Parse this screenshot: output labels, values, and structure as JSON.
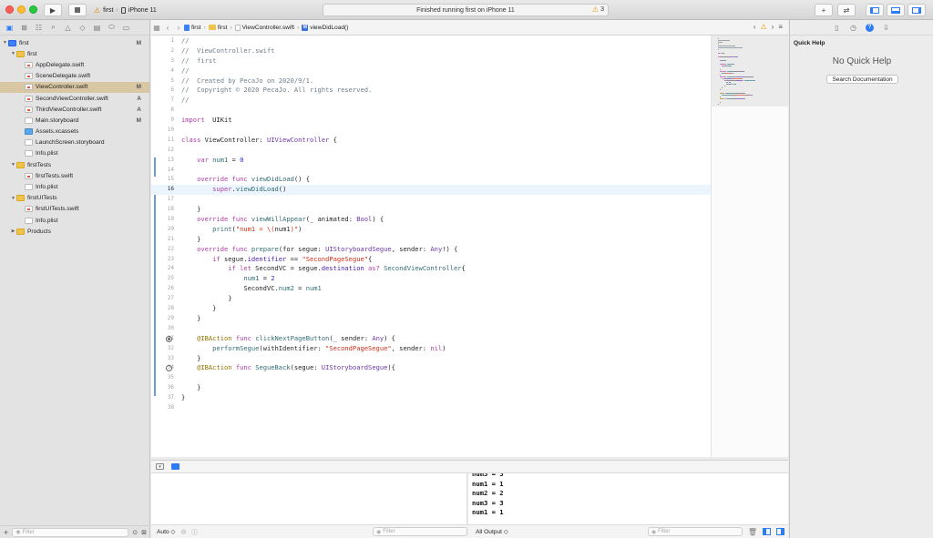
{
  "toolbar": {
    "scheme_target": "first",
    "device": "iPhone 11",
    "activity_status": "Finished running first on iPhone 11",
    "warning_count": "3"
  },
  "navigator": {
    "filter_placeholder": "Filter",
    "items": [
      {
        "label": "first",
        "icon": "project-icon",
        "indent": 0,
        "disclosure": "▼",
        "badge": "M"
      },
      {
        "label": "first",
        "icon": "folder-icon",
        "indent": 1,
        "disclosure": "▼",
        "badge": ""
      },
      {
        "label": "AppDelegate.swift",
        "icon": "swift-file-icon",
        "indent": 2,
        "disclosure": "",
        "badge": ""
      },
      {
        "label": "SceneDelegate.swift",
        "icon": "swift-file-icon",
        "indent": 2,
        "disclosure": "",
        "badge": ""
      },
      {
        "label": "ViewController.swift",
        "icon": "swift-file-icon",
        "indent": 2,
        "disclosure": "",
        "badge": "M",
        "selected": true
      },
      {
        "label": "SecondViewController.swift",
        "icon": "swift-file-icon",
        "indent": 2,
        "disclosure": "",
        "badge": "A"
      },
      {
        "label": "ThirdViewController.swift",
        "icon": "swift-file-icon",
        "indent": 2,
        "disclosure": "",
        "badge": "A"
      },
      {
        "label": "Main.storyboard",
        "icon": "storyboard-icon",
        "indent": 2,
        "disclosure": "",
        "badge": "M"
      },
      {
        "label": "Assets.xcassets",
        "icon": "assets-icon",
        "indent": 2,
        "disclosure": "",
        "badge": ""
      },
      {
        "label": "LaunchScreen.storyboard",
        "icon": "storyboard-icon",
        "indent": 2,
        "disclosure": "",
        "badge": ""
      },
      {
        "label": "Info.plist",
        "icon": "plist-icon",
        "indent": 2,
        "disclosure": "",
        "badge": ""
      },
      {
        "label": "firstTests",
        "icon": "folder-icon",
        "indent": 1,
        "disclosure": "▼",
        "badge": ""
      },
      {
        "label": "firstTests.swift",
        "icon": "swift-file-icon",
        "indent": 2,
        "disclosure": "",
        "badge": ""
      },
      {
        "label": "Info.plist",
        "icon": "plist-icon",
        "indent": 2,
        "disclosure": "",
        "badge": ""
      },
      {
        "label": "firstUITests",
        "icon": "folder-icon",
        "indent": 1,
        "disclosure": "▼",
        "badge": ""
      },
      {
        "label": "firstUITests.swift",
        "icon": "swift-file-icon",
        "indent": 2,
        "disclosure": "",
        "badge": ""
      },
      {
        "label": "Info.plist",
        "icon": "plist-icon",
        "indent": 2,
        "disclosure": "",
        "badge": ""
      },
      {
        "label": "Products",
        "icon": "folder-icon",
        "indent": 1,
        "disclosure": "▶",
        "badge": ""
      }
    ]
  },
  "jumpbar": {
    "crumbs": [
      "first",
      "first",
      "ViewController.swift",
      "viewDidLoad()"
    ]
  },
  "code": {
    "lines": [
      [
        [
          "cm",
          "//"
        ]
      ],
      [
        [
          "cm",
          "//  ViewController.swift"
        ]
      ],
      [
        [
          "cm",
          "//  first"
        ]
      ],
      [
        [
          "cm",
          "//"
        ]
      ],
      [
        [
          "cm",
          "//  Created by PecaJo on 2020/9/1."
        ]
      ],
      [
        [
          "cm",
          "//  Copyright © 2020 PecaJo. All rights reserved."
        ]
      ],
      [
        [
          "cm",
          "//"
        ]
      ],
      [],
      [
        [
          "kw",
          "import"
        ],
        [
          "",
          "  UIKit"
        ]
      ],
      [],
      [
        [
          "kw",
          "class"
        ],
        [
          "",
          " ViewController: "
        ],
        [
          "ty",
          "UIViewController"
        ],
        [
          "",
          " {"
        ]
      ],
      [],
      [
        [
          "",
          "    "
        ],
        [
          "kw",
          "var"
        ],
        [
          "vr",
          " num1"
        ],
        [
          "",
          " = "
        ],
        [
          "nm",
          "0"
        ]
      ],
      [],
      [
        [
          "",
          "    "
        ],
        [
          "kw",
          "override"
        ],
        [
          "",
          " "
        ],
        [
          "kw",
          "func"
        ],
        [
          "",
          " "
        ],
        [
          "fn",
          "viewDidLoad"
        ],
        [
          "",
          "() {"
        ]
      ],
      [
        [
          "",
          "        "
        ],
        [
          "kw",
          "super"
        ],
        [
          "",
          "."
        ],
        [
          "mthd",
          "viewDidLoad"
        ],
        [
          "",
          "()"
        ]
      ],
      [],
      [
        [
          "",
          "    }"
        ]
      ],
      [
        [
          "",
          "    "
        ],
        [
          "kw",
          "override"
        ],
        [
          "",
          " "
        ],
        [
          "kw",
          "func"
        ],
        [
          "",
          " "
        ],
        [
          "fn",
          "viewWillAppear"
        ],
        [
          "",
          "(_ animated: "
        ],
        [
          "ty",
          "Bool"
        ],
        [
          "",
          ") {"
        ]
      ],
      [
        [
          "",
          "        "
        ],
        [
          "mthd",
          "print"
        ],
        [
          "",
          "("
        ],
        [
          "st",
          "\"num1 = \\("
        ],
        [
          "",
          "num1"
        ],
        [
          "st",
          ")\""
        ],
        [
          "",
          ")"
        ]
      ],
      [
        [
          "",
          "    }"
        ]
      ],
      [
        [
          "",
          "    "
        ],
        [
          "kw",
          "override"
        ],
        [
          "",
          " "
        ],
        [
          "kw",
          "func"
        ],
        [
          "",
          " "
        ],
        [
          "fn",
          "prepare"
        ],
        [
          "",
          "(for segue: "
        ],
        [
          "ty",
          "UIStoryboardSegue"
        ],
        [
          "",
          ", sender: "
        ],
        [
          "ty",
          "Any"
        ],
        [
          "",
          "!) {"
        ]
      ],
      [
        [
          "",
          "        "
        ],
        [
          "kw",
          "if"
        ],
        [
          "",
          " segue."
        ],
        [
          "prop",
          "identifier"
        ],
        [
          "",
          " == "
        ],
        [
          "st",
          "\"SecondPageSegue\""
        ],
        [
          "",
          "{"
        ]
      ],
      [
        [
          "",
          "            "
        ],
        [
          "kw",
          "if"
        ],
        [
          "",
          " "
        ],
        [
          "kw",
          "let"
        ],
        [
          "",
          " SecondVC = segue."
        ],
        [
          "prop",
          "destination"
        ],
        [
          "",
          " "
        ],
        [
          "kw",
          "as?"
        ],
        [
          "",
          " "
        ],
        [
          "fn",
          "SecondViewController"
        ],
        [
          "",
          "{"
        ]
      ],
      [
        [
          "",
          "                "
        ],
        [
          "vr",
          "num1"
        ],
        [
          "",
          " = "
        ],
        [
          "nm",
          "2"
        ]
      ],
      [
        [
          "",
          "                SecondVC."
        ],
        [
          "vr",
          "num2"
        ],
        [
          "",
          " = "
        ],
        [
          "vr",
          "num1"
        ]
      ],
      [
        [
          "",
          "            }"
        ]
      ],
      [
        [
          "",
          "        }"
        ]
      ],
      [
        [
          "",
          "    }"
        ]
      ],
      [],
      [
        [
          "",
          "    "
        ],
        [
          "at",
          "@IBAction"
        ],
        [
          "",
          " "
        ],
        [
          "kw",
          "func"
        ],
        [
          "",
          " "
        ],
        [
          "fn",
          "clickNextPageButton"
        ],
        [
          "",
          "(_ sender: "
        ],
        [
          "ty",
          "Any"
        ],
        [
          "",
          ") {"
        ]
      ],
      [
        [
          "",
          "        "
        ],
        [
          "mthd",
          "performSegue"
        ],
        [
          "",
          "(withIdentifier: "
        ],
        [
          "st",
          "\"SecondPageSegue\""
        ],
        [
          "",
          ", sender: "
        ],
        [
          "kw",
          "nil"
        ],
        [
          "",
          ")"
        ]
      ],
      [
        [
          "",
          "    }"
        ]
      ],
      [
        [
          "",
          "    "
        ],
        [
          "at",
          "@IBAction"
        ],
        [
          "",
          " "
        ],
        [
          "kw",
          "func"
        ],
        [
          "",
          " "
        ],
        [
          "fn",
          "SegueBack"
        ],
        [
          "",
          "(segue: "
        ],
        [
          "ty",
          "UIStoryboardSegue"
        ],
        [
          "",
          "){"
        ]
      ],
      [],
      [
        [
          "",
          "    }"
        ]
      ],
      [
        [
          "",
          "}"
        ]
      ],
      []
    ],
    "current_line": 16,
    "breakpoint_filled_line": 31,
    "breakpoint_empty_line": 34
  },
  "debug": {
    "scope": "Auto ◇",
    "vars_filter_placeholder": "Filter",
    "output_selector": "All Output ◇",
    "console_filter_placeholder": "Filter",
    "console_lines": [
      "num3 = 3",
      "num1 = 1",
      "num2 = 2",
      "num3 = 3",
      "num1 = 1"
    ]
  },
  "inspector": {
    "title": "Quick Help",
    "empty_message": "No Quick Help",
    "search_button": "Search Documentation"
  }
}
